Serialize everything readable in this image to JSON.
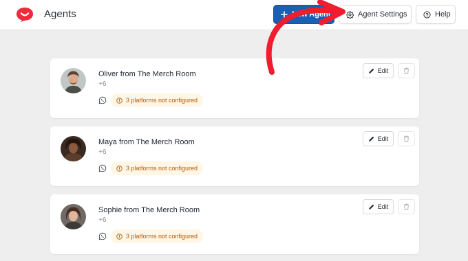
{
  "header": {
    "title": "Agents",
    "new_agent_label": "New Agent",
    "agent_settings_label": "Agent Settings",
    "help_label": "Help"
  },
  "colors": {
    "brand": "#ef2b3d",
    "primary_button": "#1a5fb4",
    "warning_badge_bg": "#fff6e5",
    "warning_badge_text": "#b4590a",
    "annotation_arrow": "#ef1d2d"
  },
  "agents": [
    {
      "name": "Oliver from The Merch Room",
      "sub": "+6",
      "platform_icon": "whatsapp-icon",
      "status": "3 platforms not configured",
      "edit_label": "Edit"
    },
    {
      "name": "Maya from The Merch Room",
      "sub": "+6",
      "platform_icon": "whatsapp-icon",
      "status": "3 platforms not configured",
      "edit_label": "Edit"
    },
    {
      "name": "Sophie from The Merch Room",
      "sub": "+6",
      "platform_icon": "whatsapp-icon",
      "status": "3 platforms not configured",
      "edit_label": "Edit"
    }
  ]
}
